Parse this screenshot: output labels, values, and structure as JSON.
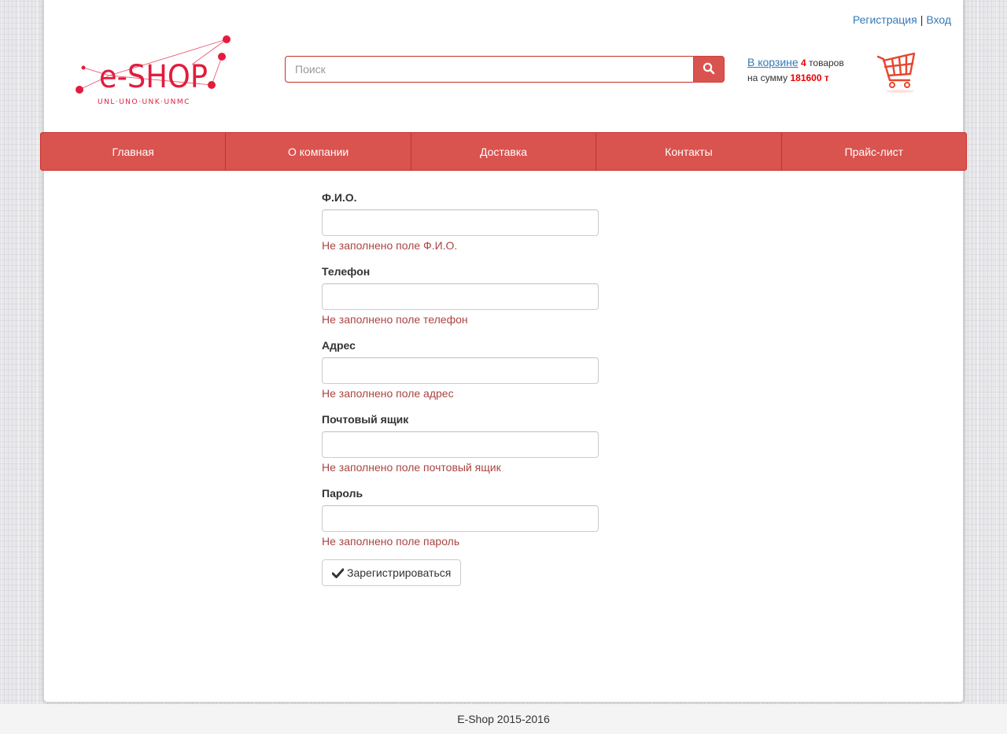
{
  "header": {
    "register_link": "Регистрация",
    "separator": "|",
    "login_link": "Вход",
    "logo": {
      "brand": "e-SHOP",
      "tagline": "UNL·UNO·UNK·UNMC",
      "accent_color": "#e31c3d"
    }
  },
  "search": {
    "placeholder": "Поиск",
    "value": "",
    "icon": "search-icon"
  },
  "cart": {
    "link_text": "В корзине",
    "count": "4",
    "items_word": "товаров",
    "sum_prefix": "на сумму",
    "sum_value": "181600 т",
    "icon": "shopping-cart-icon"
  },
  "nav": {
    "items": [
      {
        "label": "Главная"
      },
      {
        "label": "О компании"
      },
      {
        "label": "Доставка"
      },
      {
        "label": "Контакты"
      },
      {
        "label": "Прайс-лист"
      }
    ],
    "color": "#d9534f"
  },
  "form": {
    "fields": [
      {
        "label": "Ф.И.О.",
        "value": "",
        "error": "Не заполнено поле Ф.И.О."
      },
      {
        "label": "Телефон",
        "value": "",
        "error": "Не заполнено поле телефон"
      },
      {
        "label": "Адрес",
        "value": "",
        "error": "Не заполнено поле адрес"
      },
      {
        "label": "Почтовый ящик",
        "value": "",
        "error": "Не заполнено поле почтовый ящик"
      },
      {
        "label": "Пароль",
        "value": "",
        "error": "Не заполнено поле пароль"
      }
    ],
    "submit_label": "Зарегистрироваться",
    "submit_icon": "checkmark-icon",
    "error_color": "#a94442"
  },
  "footer": {
    "text": "E-Shop 2015-2016"
  }
}
